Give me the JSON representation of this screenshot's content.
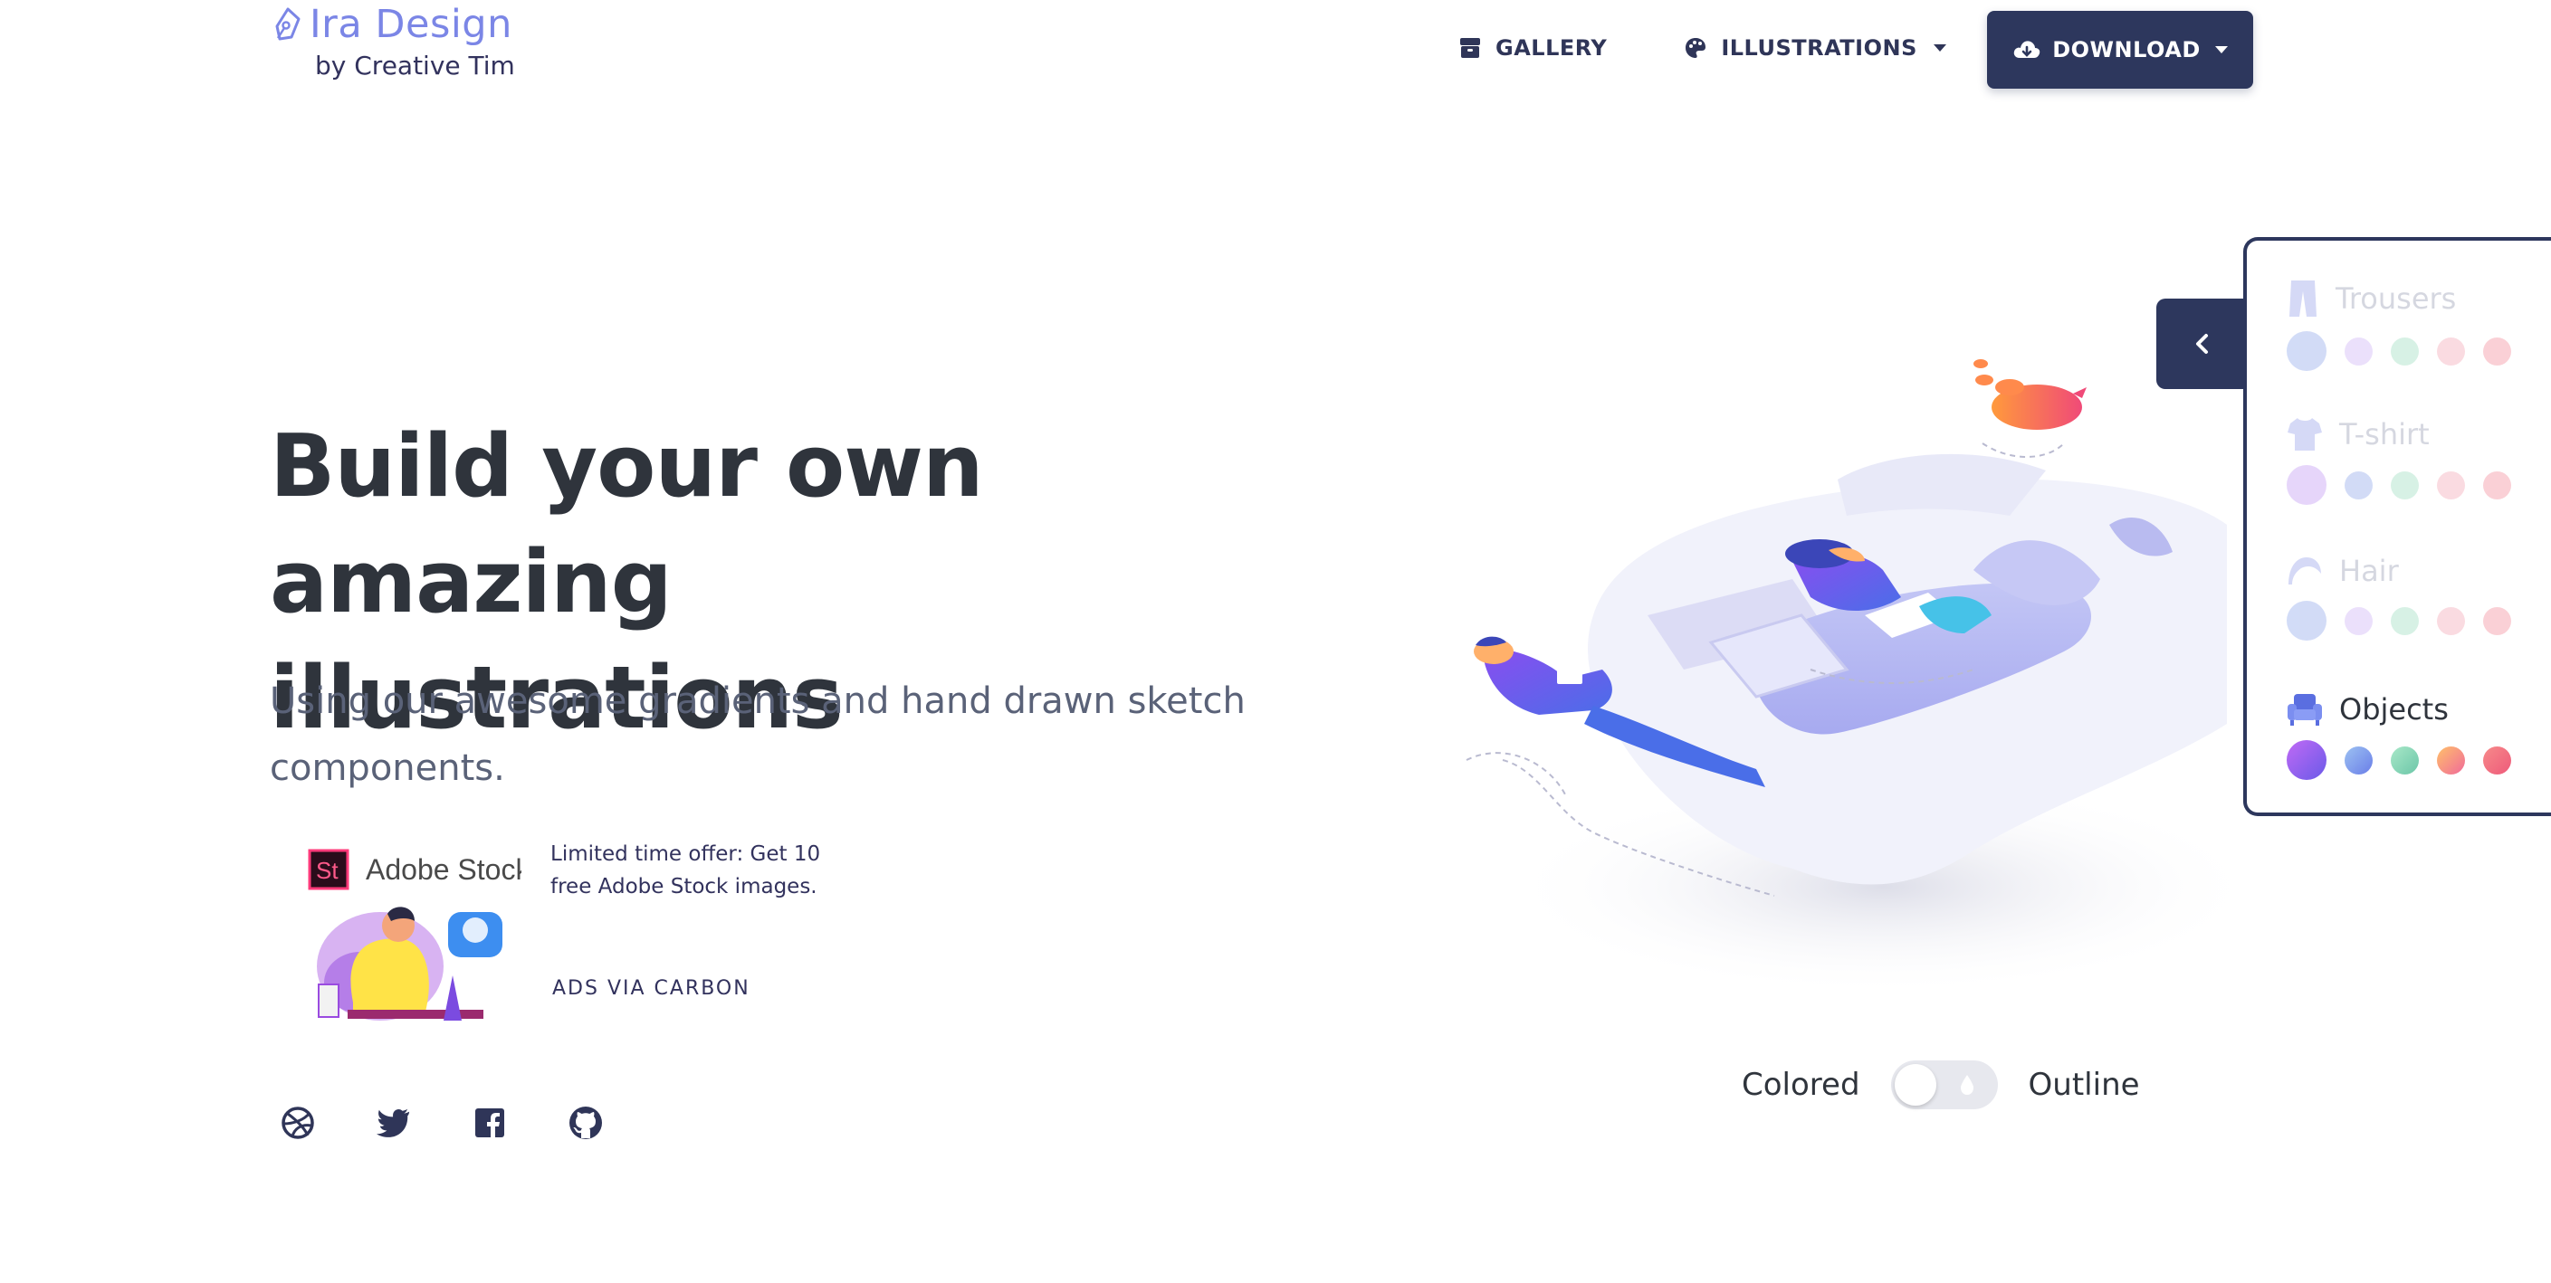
{
  "brand": {
    "name": "Ira Design",
    "byline": "by Creative Tim"
  },
  "nav": {
    "gallery": "GALLERY",
    "illustrations": "ILLUSTRATIONS",
    "download": "DOWNLOAD"
  },
  "hero": {
    "title_line1": "Build your own amazing",
    "title_line2": "illustrations",
    "subtitle_line1": "Using our awesome gradients and hand drawn sketch",
    "subtitle_line2": "components."
  },
  "ad": {
    "brand": "Adobe Stock",
    "logo_text": "St",
    "offer_line1": "Limited time offer: Get 10",
    "offer_line2": "free Adobe Stock images.",
    "via": "ADS VIA CARBON"
  },
  "social": [
    "dribbble-icon",
    "twitter-icon",
    "facebook-icon",
    "github-icon"
  ],
  "toggle": {
    "left_label": "Colored",
    "right_label": "Outline",
    "state": "Colored"
  },
  "panel": {
    "categories": [
      {
        "label": "Trousers",
        "active": false
      },
      {
        "label": "T-shirt",
        "active": false
      },
      {
        "label": "Hair",
        "active": false
      },
      {
        "label": "Objects",
        "active": true
      }
    ]
  },
  "colors": {
    "accent_dark": "#2d375d",
    "brand_blue": "#7b86e6",
    "swatch_purple": "#8d5cf0",
    "swatch_blue": "#7f9be8",
    "swatch_green": "#8ed9b6",
    "swatch_orange": "#f39bab",
    "swatch_red": "#f37c8c"
  }
}
